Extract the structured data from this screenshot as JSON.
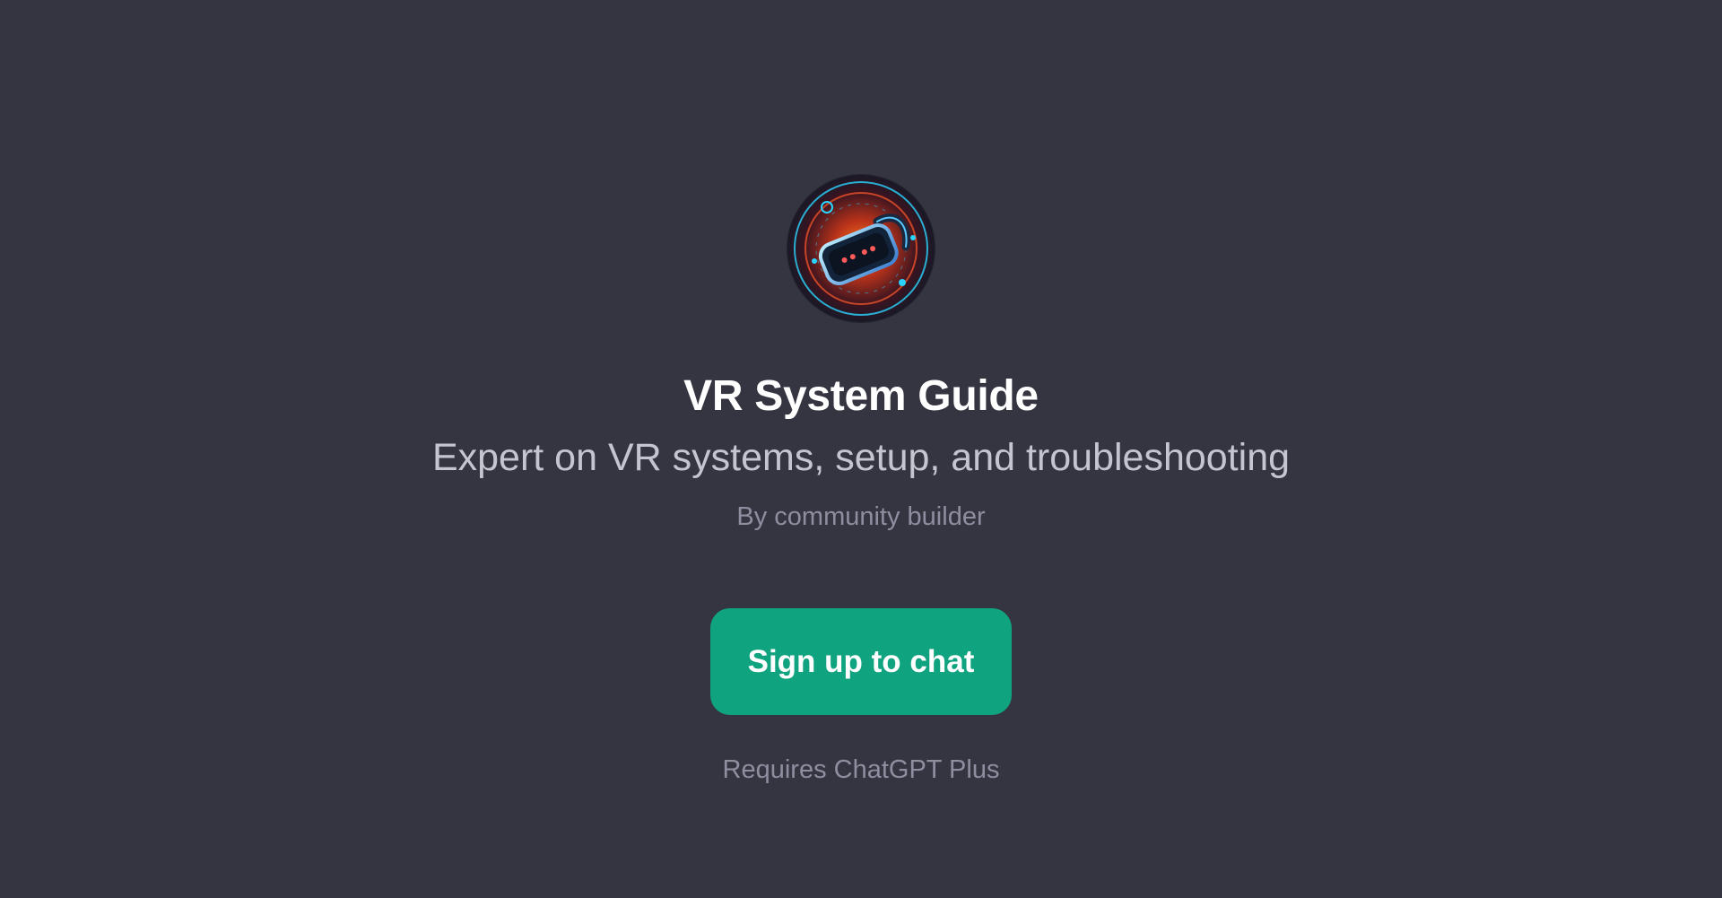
{
  "gpt": {
    "avatar_icon": "vr-headset-icon",
    "title": "VR System Guide",
    "description": "Expert on VR systems, setup, and troubleshooting",
    "author": "By community builder"
  },
  "cta": {
    "signup_label": "Sign up to chat",
    "requirement": "Requires ChatGPT Plus"
  },
  "colors": {
    "background": "#353541",
    "title": "#ffffff",
    "description": "#c5c5d2",
    "muted": "#8e8ea0",
    "accent": "#10a37f"
  }
}
